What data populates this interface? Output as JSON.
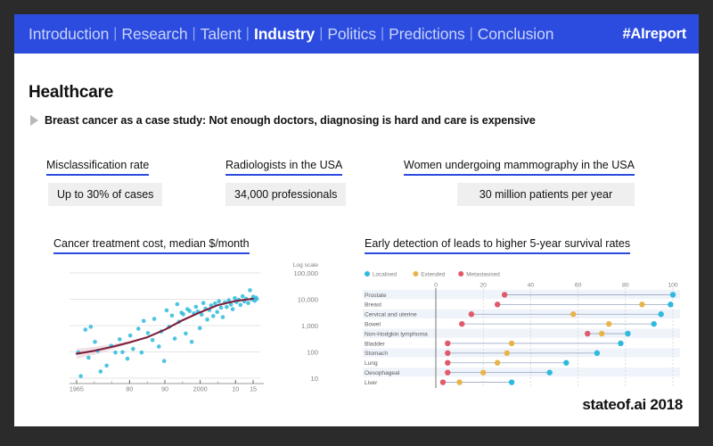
{
  "nav": {
    "items": [
      {
        "label": "Introduction",
        "active": false
      },
      {
        "label": "Research",
        "active": false
      },
      {
        "label": "Talent",
        "active": false
      },
      {
        "label": "Industry",
        "active": true
      },
      {
        "label": "Politics",
        "active": false
      },
      {
        "label": "Predictions",
        "active": false
      },
      {
        "label": "Conclusion",
        "active": false
      }
    ],
    "separator": "|",
    "hashtag": "#AIreport",
    "background_color": "#2c4ce0",
    "active_color": "#ffffff",
    "inactive_color": "#c9d4f8"
  },
  "page_title": "Healthcare",
  "subtitle": "Breast cancer as a case study: Not enough doctors, diagnosing is hard and care is expensive",
  "stats": [
    {
      "label": "Misclassification rate",
      "value": "Up to 30% of cases"
    },
    {
      "label": "Radiologists in the USA",
      "value": "34,000 professionals"
    },
    {
      "label": "Women undergoing mammography in the USA",
      "value": "30 million patients per year"
    }
  ],
  "charts": {
    "left_title": "Cancer treatment cost, median $/month",
    "right_title": "Early detection of leads to higher 5-year survival rates"
  },
  "footer": "stateof.ai 2018",
  "accent_color": "#2c4ce0",
  "chart_data": [
    {
      "type": "scatter",
      "title": "Cancer treatment cost, median $/month",
      "xlabel": "",
      "ylabel": "Log scale",
      "y_axis_note": "Log scale",
      "ytick_labels": [
        "100,000",
        "10,000",
        "1,000",
        "100",
        "10"
      ],
      "ytick_values": [
        100000,
        10000,
        1000,
        100,
        10
      ],
      "xtick_labels": [
        "1965",
        "80",
        "90",
        "2000",
        "10",
        "15"
      ],
      "xtick_values": [
        1965,
        1980,
        1990,
        2000,
        2010,
        2015
      ],
      "xlim": [
        1963,
        2017
      ],
      "ylim": [
        10,
        100000
      ],
      "grid": true,
      "point_color": "#2ebadd",
      "trend_color": "#7d1f3c",
      "trend_band_color": "#e8c9d2",
      "legend": [],
      "points": [
        [
          1965.5,
          95
        ],
        [
          1966.2,
          12
        ],
        [
          1967.5,
          700
        ],
        [
          1968.4,
          60
        ],
        [
          1969.0,
          900
        ],
        [
          1970.2,
          240
        ],
        [
          1971.0,
          110
        ],
        [
          1971.8,
          18
        ],
        [
          1973.5,
          30
        ],
        [
          1974.8,
          170
        ],
        [
          1976.0,
          95
        ],
        [
          1977.2,
          300
        ],
        [
          1978.0,
          98
        ],
        [
          1979.4,
          55
        ],
        [
          1980.2,
          420
        ],
        [
          1981.0,
          130
        ],
        [
          1982.5,
          760
        ],
        [
          1983.4,
          95
        ],
        [
          1984.0,
          1500
        ],
        [
          1985.2,
          520
        ],
        [
          1986.5,
          280
        ],
        [
          1987.0,
          1800
        ],
        [
          1988.3,
          160
        ],
        [
          1989.0,
          600
        ],
        [
          1989.8,
          45
        ],
        [
          1990.5,
          3800
        ],
        [
          1991.2,
          900
        ],
        [
          1992.0,
          2400
        ],
        [
          1992.8,
          320
        ],
        [
          1993.5,
          6500
        ],
        [
          1994.0,
          1400
        ],
        [
          1994.7,
          3100
        ],
        [
          1995.2,
          2700
        ],
        [
          1995.9,
          500
        ],
        [
          1996.4,
          4200
        ],
        [
          1997.0,
          3600
        ],
        [
          1997.6,
          240
        ],
        [
          1998.2,
          2900
        ],
        [
          1998.8,
          5200
        ],
        [
          1999.3,
          3400
        ],
        [
          1999.9,
          800
        ],
        [
          2000.4,
          2600
        ],
        [
          2000.9,
          7200
        ],
        [
          2001.5,
          4400
        ],
        [
          2002.0,
          1700
        ],
        [
          2002.6,
          3900
        ],
        [
          2003.1,
          5800
        ],
        [
          2003.7,
          2300
        ],
        [
          2004.2,
          6900
        ],
        [
          2004.8,
          3300
        ],
        [
          2005.3,
          8400
        ],
        [
          2005.9,
          4800
        ],
        [
          2006.4,
          2100
        ],
        [
          2007.0,
          7600
        ],
        [
          2007.5,
          5100
        ],
        [
          2008.1,
          9200
        ],
        [
          2008.7,
          6300
        ],
        [
          2009.2,
          4200
        ],
        [
          2009.8,
          11000
        ],
        [
          2010.3,
          7800
        ],
        [
          2010.9,
          9600
        ],
        [
          2011.4,
          6100
        ],
        [
          2012.0,
          13000
        ],
        [
          2012.5,
          8300
        ],
        [
          2013.0,
          10500
        ],
        [
          2013.6,
          7200
        ],
        [
          2014.1,
          22000
        ],
        [
          2014.6,
          9900
        ],
        [
          2015.0,
          12500
        ],
        [
          2015.4,
          8700
        ],
        [
          2015.8,
          11500
        ],
        [
          2016.0,
          10200
        ]
      ],
      "trend": [
        [
          1965,
          85
        ],
        [
          1970,
          110
        ],
        [
          1975,
          155
        ],
        [
          1980,
          230
        ],
        [
          1985,
          360
        ],
        [
          1990,
          700
        ],
        [
          1995,
          1600
        ],
        [
          2000,
          3200
        ],
        [
          2005,
          6000
        ],
        [
          2010,
          8600
        ],
        [
          2015,
          10500
        ]
      ]
    },
    {
      "type": "scatter",
      "subtype": "dot-plot",
      "title": "Early detection of leads to higher 5-year survival rates",
      "xlabel": "",
      "ylabel": "",
      "xlim": [
        0,
        100
      ],
      "xtick_labels": [
        "0",
        "20",
        "40",
        "60",
        "80",
        "100"
      ],
      "xtick_values": [
        0,
        20,
        40,
        60,
        80,
        100
      ],
      "grid": true,
      "legend_position": "top-left",
      "legend": [
        {
          "name": "Localised",
          "color": "#2ebadd"
        },
        {
          "name": "Extended",
          "color": "#e8b44a"
        },
        {
          "name": "Metastasised",
          "color": "#e05a6a"
        }
      ],
      "categories": [
        "Prostate",
        "Breast",
        "Cervical and uterine",
        "Bowel",
        "Non-Hodgkin lymphoma",
        "Bladder",
        "Stomach",
        "Lung",
        "Oesophageal",
        "Liver"
      ],
      "series": [
        {
          "name": "Localised",
          "color": "#2ebadd",
          "values": [
            100,
            99,
            95,
            92,
            81,
            78,
            68,
            55,
            48,
            32
          ]
        },
        {
          "name": "Extended",
          "color": "#e8b44a",
          "values": [
            null,
            87,
            58,
            73,
            70,
            32,
            30,
            26,
            20,
            10
          ]
        },
        {
          "name": "Metastasised",
          "color": "#e05a6a",
          "values": [
            29,
            26,
            15,
            11,
            64,
            5,
            5,
            5,
            5,
            3
          ]
        }
      ]
    }
  ]
}
